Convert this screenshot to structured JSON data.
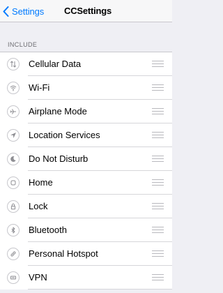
{
  "navbar": {
    "back_label": "Settings",
    "title": "CCSettings"
  },
  "section": {
    "header": "INCLUDE"
  },
  "items": [
    {
      "label": "Cellular Data",
      "icon": "cellular-data-icon"
    },
    {
      "label": "Wi-Fi",
      "icon": "wifi-icon"
    },
    {
      "label": "Airplane Mode",
      "icon": "airplane-icon"
    },
    {
      "label": "Location Services",
      "icon": "location-arrow-icon"
    },
    {
      "label": "Do Not Disturb",
      "icon": "moon-icon"
    },
    {
      "label": "Home",
      "icon": "home-button-icon"
    },
    {
      "label": "Lock",
      "icon": "lock-icon"
    },
    {
      "label": "Bluetooth",
      "icon": "bluetooth-icon"
    },
    {
      "label": "Personal Hotspot",
      "icon": "link-icon"
    },
    {
      "label": "VPN",
      "icon": "vpn-icon"
    }
  ],
  "colors": {
    "accent": "#007aff",
    "background": "#efeff4",
    "separator": "#c8c7cc",
    "icon": "#8e8e93"
  }
}
